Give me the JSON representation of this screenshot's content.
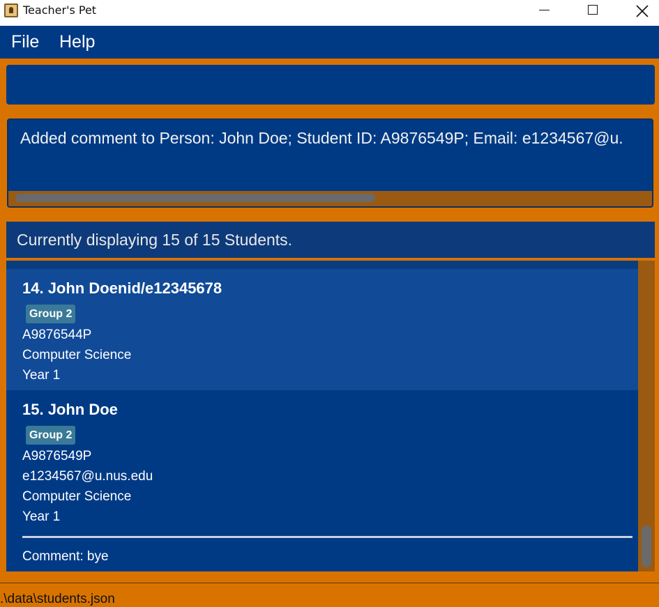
{
  "window": {
    "title": "Teacher's Pet",
    "icon": "person-portrait-icon"
  },
  "menu": {
    "items": [
      "File",
      "Help"
    ]
  },
  "command_box": {
    "value": ""
  },
  "result_display": {
    "text": "Added comment to Person: John Doe; Student ID: A9876549P; Email: e1234567@u."
  },
  "list_header": {
    "text": "Currently displaying 15 of 15 Students."
  },
  "students": [
    {
      "name": "14. John Doenid/e12345678",
      "tag": "Group 2",
      "student_id": "A9876544P",
      "major": "Computer Science",
      "year": "Year 1"
    },
    {
      "name": "15. John Doe",
      "tag": "Group 2",
      "student_id": "A9876549P",
      "email": "e1234567@u.nus.edu",
      "major": "Computer Science",
      "year": "Year 1",
      "comment": "Comment: bye"
    }
  ],
  "footer": {
    "path": ".\\data\\students.json"
  },
  "colors": {
    "background": "#d97300",
    "panel": "#003a85",
    "selected_card": "#114a97",
    "tag": "#3a7a98"
  }
}
